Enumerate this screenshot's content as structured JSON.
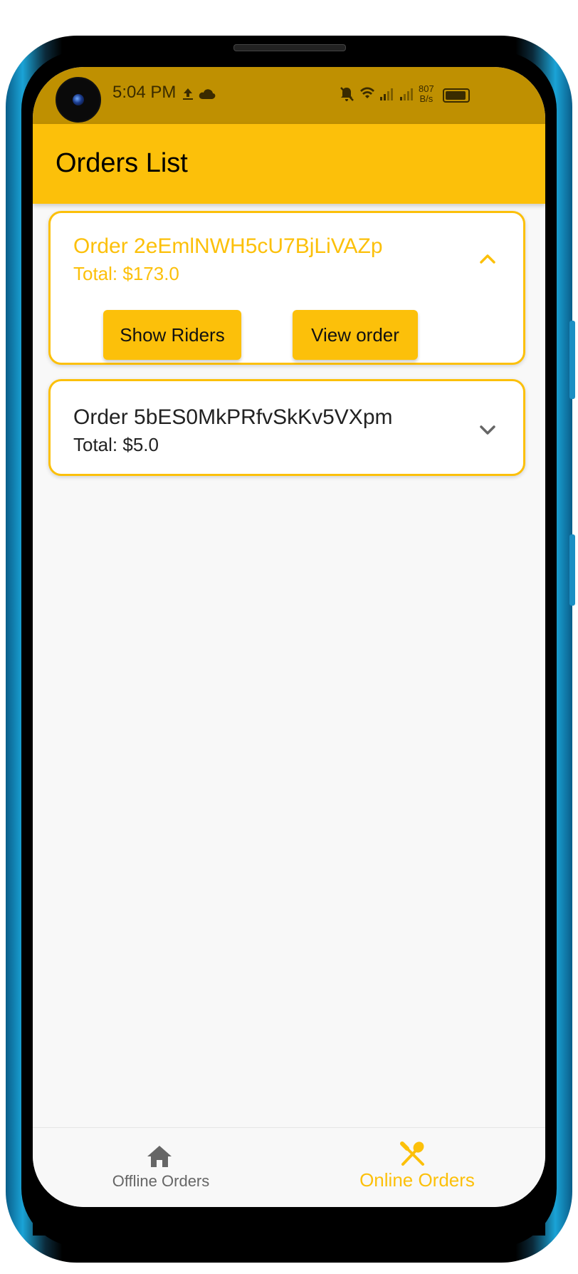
{
  "status_bar": {
    "time": "5:04 PM",
    "network_speed_value": "807",
    "network_speed_unit": "B/s",
    "icons": [
      "upload-icon",
      "cloud-icon",
      "bell-off-icon",
      "wifi-icon",
      "signal-icon",
      "signal-icon",
      "battery-icon"
    ]
  },
  "app_bar": {
    "title": "Orders List"
  },
  "orders": [
    {
      "title": "Order 2eEmlNWH5cU7BjLiVAZp",
      "total": "Total: $173.0",
      "expanded": true,
      "chevron": "chevron-up-icon",
      "actions": [
        "Show Riders",
        "View order"
      ]
    },
    {
      "title": "Order 5bES0MkPRfvSkKv5VXpm",
      "total": "Total: $5.0",
      "expanded": false,
      "chevron": "chevron-down-icon"
    }
  ],
  "bottom_nav": {
    "items": [
      {
        "label": "Offline Orders",
        "icon": "home-icon",
        "active": false
      },
      {
        "label": "Online Orders",
        "icon": "dining-icon",
        "active": true
      }
    ]
  },
  "colors": {
    "accent": "#fcc00a",
    "status_bar": "#bf9001",
    "active_text": "#fcc00a",
    "inactive_text": "#666666"
  }
}
